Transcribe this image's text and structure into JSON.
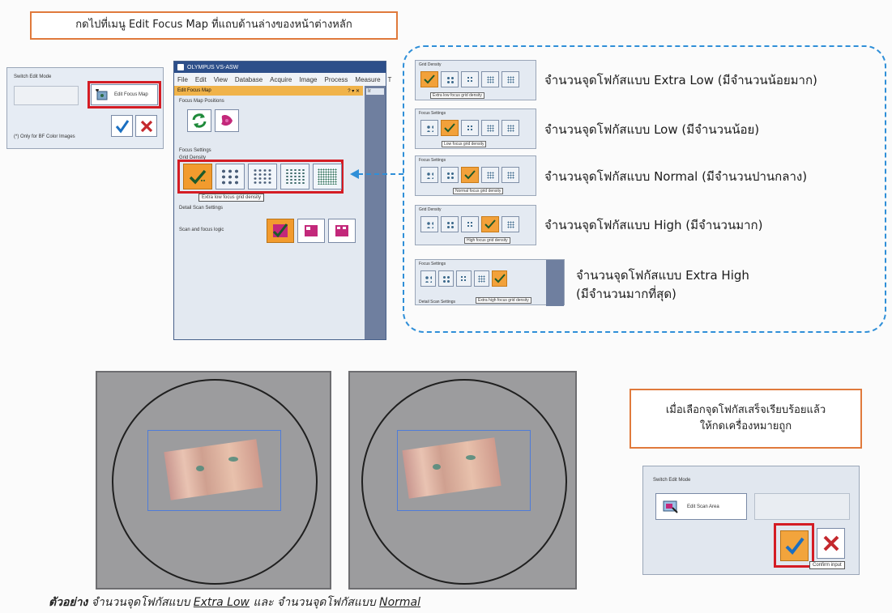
{
  "top_instruction": "กดไปที่เมนู Edit Focus Map ที่แถบด้านล่างของหน้าต่างหลัก",
  "small_panel": {
    "mode_label": "Switch Edit Mode",
    "edit_focus_label": "Edit Focus Map",
    "note": "(*) Only for BF Color Images"
  },
  "main_window": {
    "app_title": "OLYMPUS VS-ASW",
    "menu": [
      "File",
      "Edit",
      "View",
      "Database",
      "Acquire",
      "Image",
      "Process",
      "Measure",
      "T"
    ],
    "panel_title": "Edit Focus Map",
    "panel_controls": "? ▾ ✕",
    "right_tab": "Ir",
    "focus_positions_label": "Focus Map Positions",
    "focus_settings_label": "Focus Settings",
    "grid_density_label": "Grid Density",
    "tooltip": "Extra low focus grid density",
    "detail_label": "Detail Scan Settings",
    "scan_logic_label": "Scan and focus logic"
  },
  "density_options": [
    {
      "thumb_head": "Grid Density",
      "tooltip": "Extra low focus grid density",
      "label": "จำนวนจุดโฟกัสแบบ Extra Low (มีจำนวนน้อยมาก)",
      "selected": 0
    },
    {
      "thumb_head": "Focus Settings",
      "tooltip": "Low focus grid density",
      "label": "จำนวนจุดโฟกัสแบบ Low (มีจำนวนน้อย)",
      "selected": 1
    },
    {
      "thumb_head": "Focus Settings",
      "tooltip": "Normal focus grid density",
      "label": "จำนวนจุดโฟกัสแบบ Normal (มีจำนวนปานกลาง)",
      "selected": 2
    },
    {
      "thumb_head": "Grid Density",
      "tooltip": "High focus grid density",
      "label": "จำนวนจุดโฟกัสแบบ High (มีจำนวนมาก)",
      "selected": 3
    },
    {
      "thumb_head": "Focus Settings",
      "tooltip": "Extra high focus grid density",
      "label_line1": "จำนวนจุดโฟกัสแบบ Extra High",
      "label_line2": "(มีจำนวนมากที่สุด)",
      "footer": "Detail Scan Settings",
      "selected": 4
    }
  ],
  "confirm_callout": {
    "line1": "เมื่อเลือกจุดโฟกัสเสร็จเรียบร้อยแล้ว",
    "line2": "ให้กดเครื่องหมายถูก"
  },
  "confirm_panel": {
    "mode_label": "Switch Edit Mode",
    "scan_area_label": "Edit Scan Area",
    "confirm_tooltip": "Confirm input"
  },
  "caption": {
    "prefix": "ตัวอย่าง",
    "part1": " จำนวนจุดโฟกัสแบบ ",
    "option1": "Extra Low",
    "part2": " และ จำนวนจุดโฟกัสแบบ ",
    "option2": "Normal"
  },
  "colors": {
    "accent_orange": "#f29b2e",
    "red_highlight": "#d41c24",
    "dashed_blue": "#2f8fd8",
    "callout_border": "#e07a3c",
    "window_blue": "#2d4f8a"
  }
}
